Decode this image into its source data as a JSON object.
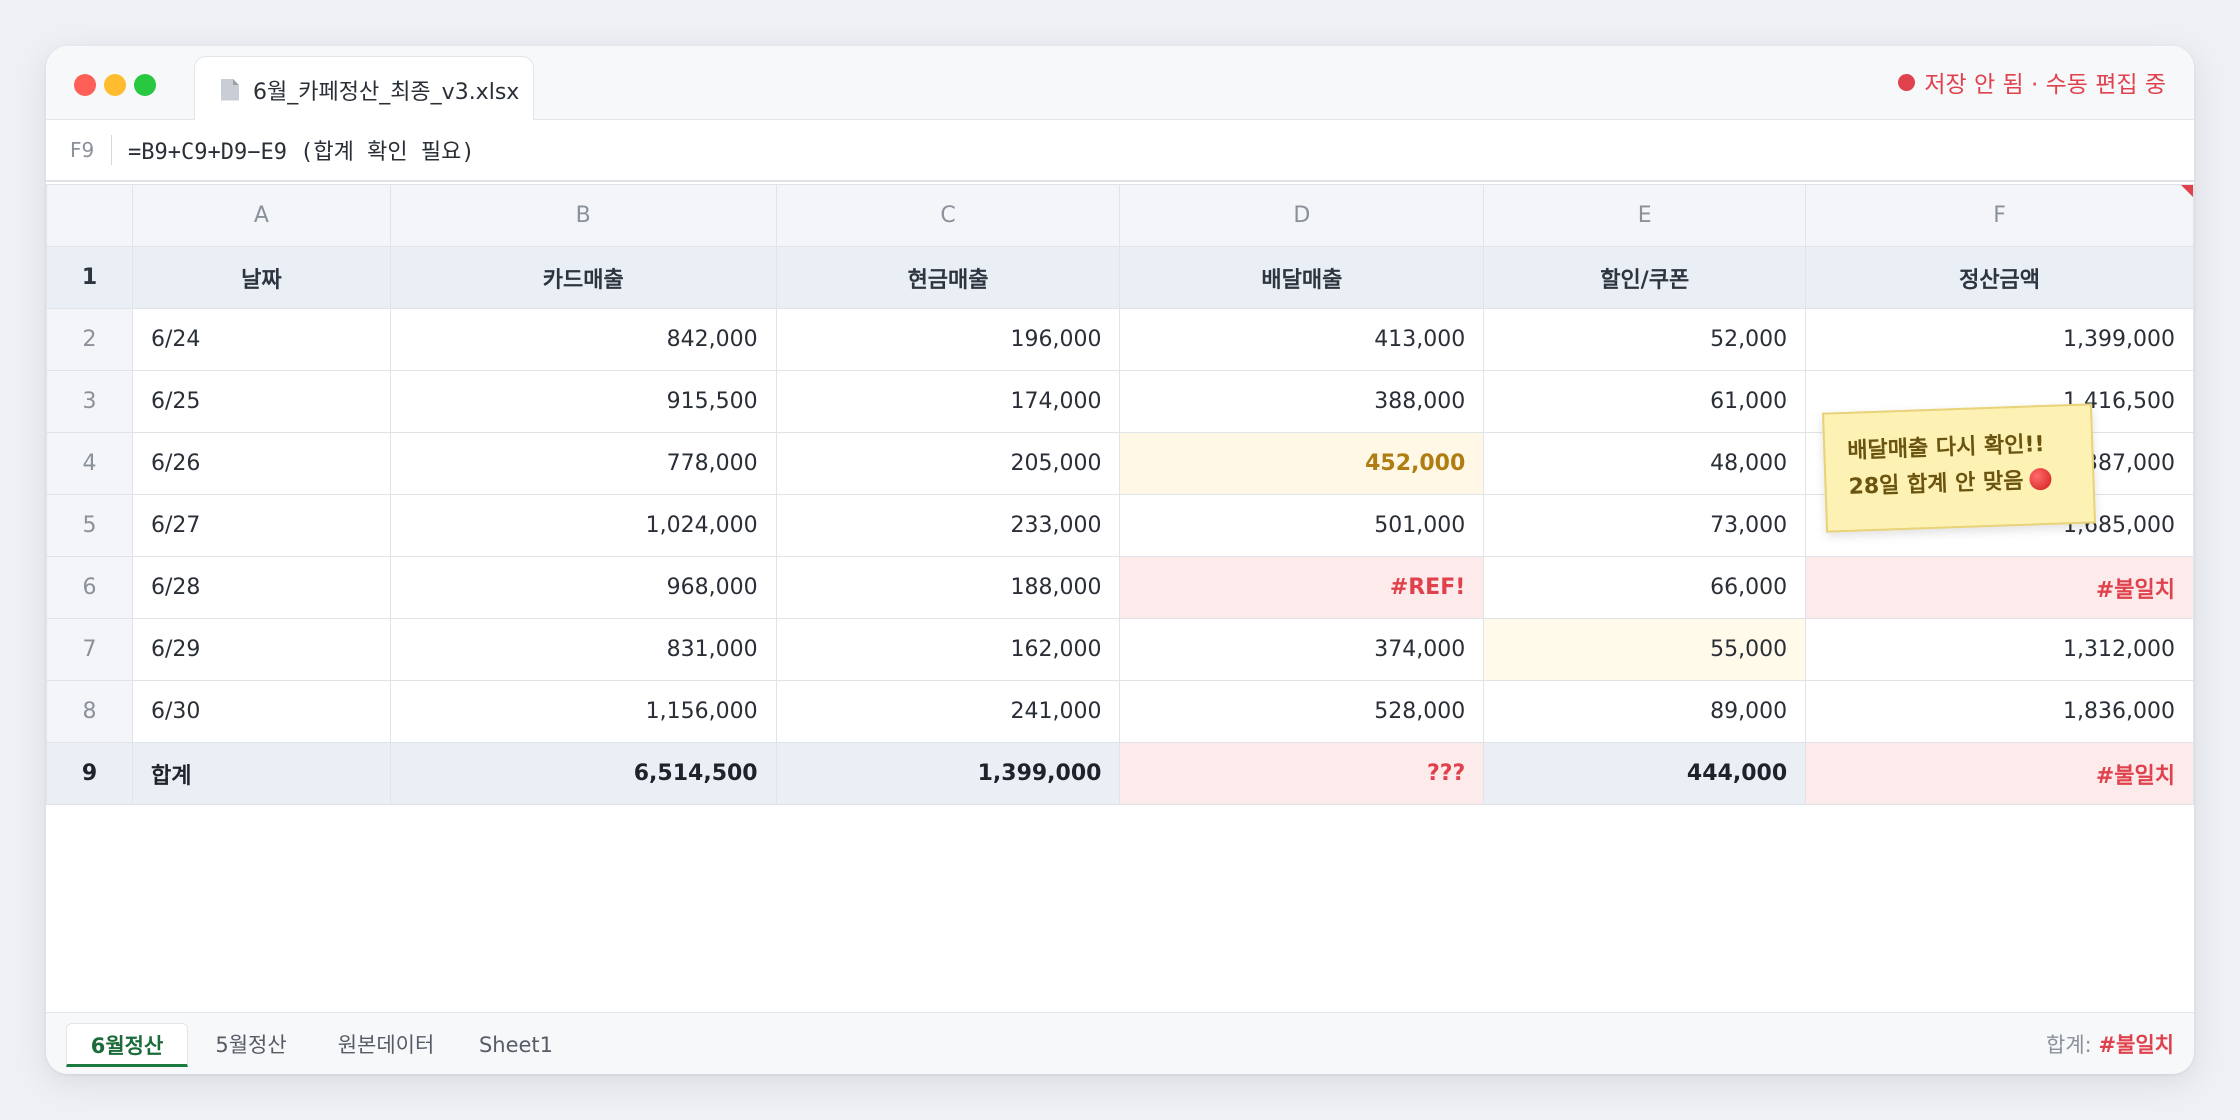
{
  "window": {
    "file_name": "6월_카페정산_최종_v3.xlsx",
    "save_status": "저장 안 됨 · 수동 편집 중",
    "colors": {
      "error": "#e0424d",
      "warn": "#b07d12",
      "active_sheet": "#1c6b3a"
    }
  },
  "formula_bar": {
    "cell_ref": "F9",
    "formula": "=B9+C9+D9−E9 (합계 확인 필요)"
  },
  "columns": [
    "A",
    "B",
    "C",
    "D",
    "E",
    "F"
  ],
  "header_row": [
    "날짜",
    "카드매출",
    "현금매출",
    "배달매출",
    "할인/쿠폰",
    "정산금액"
  ],
  "rows": [
    {
      "num": "2",
      "cells": [
        "6/24",
        "842,000",
        "196,000",
        "413,000",
        "52,000",
        "1,399,000"
      ]
    },
    {
      "num": "3",
      "cells": [
        "6/25",
        "915,500",
        "174,000",
        "388,000",
        "61,000",
        "1,416,500"
      ]
    },
    {
      "num": "4",
      "cells": [
        "6/26",
        "778,000",
        "205,000",
        "452,000",
        "48,000",
        "1,387,000"
      ]
    },
    {
      "num": "5",
      "cells": [
        "6/27",
        "1,024,000",
        "233,000",
        "501,000",
        "73,000",
        "1,685,000"
      ]
    },
    {
      "num": "6",
      "cells": [
        "6/28",
        "968,000",
        "188,000",
        "#REF!",
        "66,000",
        "#불일치"
      ]
    },
    {
      "num": "7",
      "cells": [
        "6/29",
        "831,000",
        "162,000",
        "374,000",
        "55,000",
        "1,312,000"
      ]
    },
    {
      "num": "8",
      "cells": [
        "6/30",
        "1,156,000",
        "241,000",
        "528,000",
        "89,000",
        "1,836,000"
      ]
    }
  ],
  "total_row": {
    "num": "9",
    "cells": [
      "합계",
      "6,514,500",
      "1,399,000",
      "???",
      "444,000",
      "#불일치"
    ]
  },
  "header_row_num": "1",
  "sticky_note": {
    "line1": "배달매출 다시 확인!!",
    "line2": "28일 합계 안 맞음"
  },
  "sheets": [
    "6월정산",
    "5월정산",
    "원본데이터",
    "Sheet1"
  ],
  "status_bar": {
    "label": "합계:",
    "value": "#불일치"
  }
}
